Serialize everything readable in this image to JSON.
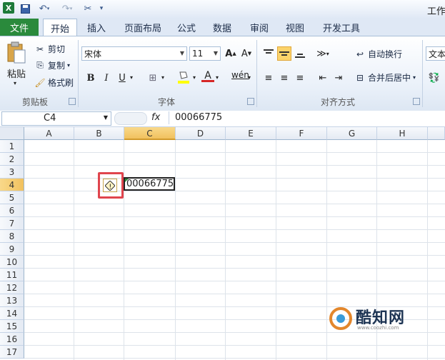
{
  "window": {
    "title": "工作"
  },
  "qat": {
    "save_icon": "save-icon",
    "undo_icon": "undo-icon",
    "redo_icon": "redo-icon"
  },
  "tabs": {
    "file": "文件",
    "items": [
      "开始",
      "插入",
      "页面布局",
      "公式",
      "数据",
      "审阅",
      "视图",
      "开发工具"
    ]
  },
  "clipboard": {
    "paste": "粘贴",
    "cut": "剪切",
    "copy": "复制",
    "format_painter": "格式刷",
    "group": "剪贴板"
  },
  "font": {
    "name": "宋体",
    "size": "11",
    "bold": "B",
    "italic": "I",
    "underline": "U",
    "group": "字体",
    "phonetic": "wén"
  },
  "alignment": {
    "wrap": "自动换行",
    "merge": "合并后居中",
    "group": "对齐方式"
  },
  "number": {
    "format": "文本"
  },
  "formula_bar": {
    "name_box": "C4",
    "fx": "fx",
    "value": "00066775"
  },
  "sheet": {
    "columns": [
      "A",
      "B",
      "C",
      "D",
      "E",
      "F",
      "G",
      "H"
    ],
    "rows": [
      "1",
      "2",
      "3",
      "4",
      "5",
      "6",
      "7",
      "8",
      "9",
      "10",
      "11",
      "12",
      "13",
      "14",
      "15",
      "16",
      "17"
    ],
    "active_cell": {
      "ref": "C4",
      "value": "00066775"
    }
  },
  "watermark": {
    "text": "酷知网",
    "url": "www.coozhi.com"
  },
  "colors": {
    "file_tab": "#2a8a3c",
    "active_header": "#f1c15e",
    "error_highlight": "#e0454d",
    "error_triangle": "#2c8a3a"
  }
}
